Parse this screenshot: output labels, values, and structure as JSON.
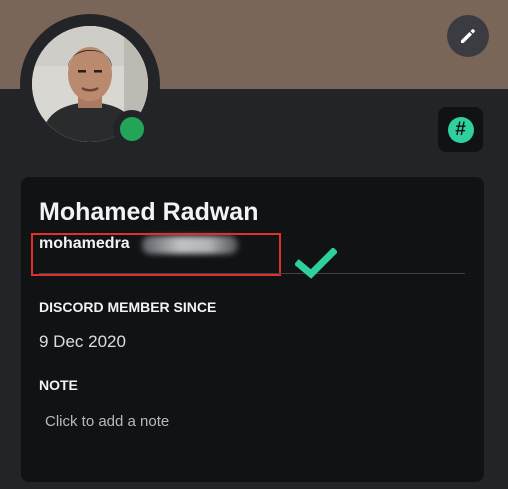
{
  "profile": {
    "display_name": "Mohamed Radwan",
    "username_visible": "mohamedra",
    "status": "online",
    "badge_glyph": "#",
    "banner_color": "#7a6659",
    "status_color": "#23a559",
    "badge_color": "#2fd0a0",
    "annotation_box_color": "#e0302e",
    "checkmark_color": "#2fd0a0"
  },
  "member_since": {
    "heading": "DISCORD MEMBER SINCE",
    "date": "9 Dec 2020"
  },
  "note": {
    "heading": "NOTE",
    "placeholder": "Click to add a note"
  },
  "icons": {
    "edit": "pencil-icon",
    "badge": "hashtag-icon",
    "annotation": "checkmark-icon"
  }
}
